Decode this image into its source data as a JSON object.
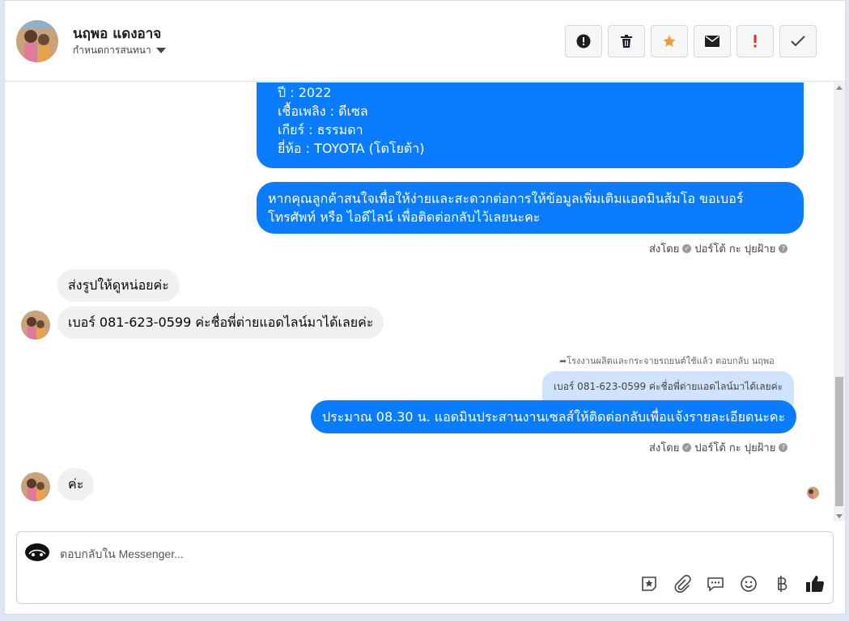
{
  "header": {
    "contact_name": "นฤพอ แดงอาจ",
    "subtitle": "กำหนดการสนทนา",
    "toolbar": [
      "exclamation-circle-icon",
      "trash-icon",
      "star-icon",
      "envelope-icon",
      "exclamation-icon",
      "check-icon"
    ]
  },
  "messages": {
    "car_info_lines": [
      "ปี : 2022",
      "เชื้อเพลิง : ดีเซล",
      "เกียร์ : ธรรมดา",
      "ยี่ห้อ : TOYOTA (โตโยต้า)"
    ],
    "out1_line1": "หากคุณลูกค้าสนใจเพื่อให้ง่ายและสะดวกต่อการให้ข้อมูลเพิ่มเติมแอดมินส้มโอ ขอเบอร์",
    "out1_line2": "โทรศัพท์ หรือ ไอดีไลน์ เพื่อติดต่อกลับไว้เลยนะคะ",
    "sent_by_1": "ส่งโดย",
    "sender_1": "ปอร์โต้ กะ ปุยฝ้าย",
    "in1": "ส่งรูปให้ดูหน่อยค่ะ",
    "in2": "เบอร์ 081-623-0599 ค่ะชื่อพี่ต่ายแอดไลน์มาได้เลยค่ะ",
    "reply_ref": "โรงงานผลิตและกระจายรถยนต์ใช้แล้ว ตอบกลับ นฤพอ",
    "quoted": "เบอร์ 081-623-0599 ค่ะชื่อพี่ต่ายแอดไลน์มาได้เลยค่ะ",
    "out2": "ประมาณ 08.30 น. แอดมินประสานงานเซลส์ให้ติดต่อกลับเพื่อแจ้งรายละเอียดนะคะ",
    "sent_by_2": "ส่งโดย",
    "sender_2": "ปอร์โต้ กะ ปุยฝ้าย",
    "in3": "ค่ะ"
  },
  "composer": {
    "placeholder": "ตอบกลับใน Messenger...",
    "icons": [
      "sticker-icon",
      "attach-icon",
      "saved-reply-icon",
      "emoji-icon",
      "baht-icon",
      "like-icon"
    ]
  },
  "colors": {
    "accent": "#0a7cff",
    "incoming": "#f0f0f0",
    "quoted": "#cfe3fc"
  }
}
